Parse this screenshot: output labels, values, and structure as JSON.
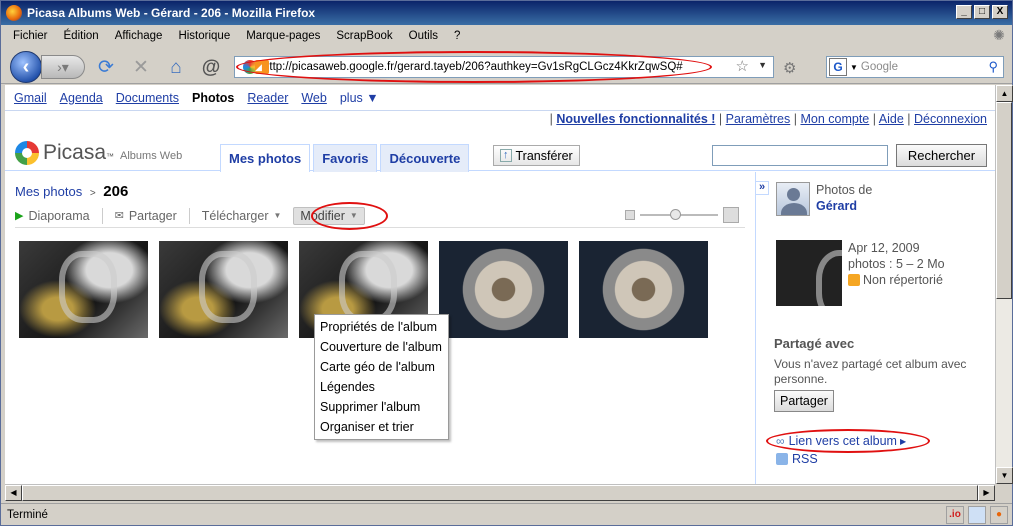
{
  "window": {
    "title": "Picasa Albums Web - Gérard - 206 - Mozilla Firefox",
    "buttons": [
      "_",
      "□",
      "X"
    ]
  },
  "menu": [
    "Fichier",
    "Édition",
    "Affichage",
    "Historique",
    "Marque-pages",
    "ScrapBook",
    "Outils",
    "?"
  ],
  "toolbar": {
    "url": "http://picasaweb.google.fr/gerard.tayeb/206?authkey=Gv1sRgCLGcz4KkrZqwSQ#",
    "search_placeholder": "Google"
  },
  "google_bar": {
    "links": [
      "Gmail",
      "Agenda",
      "Documents",
      "Photos",
      "Reader",
      "Web",
      "plus ▼"
    ],
    "current": "Photos"
  },
  "top_links": {
    "new_features": "Nouvelles fonctionnalités !",
    "settings": "Paramètres",
    "account": "Mon compte",
    "help": "Aide",
    "logout": "Déconnexion",
    "sep": "|"
  },
  "picasa": {
    "logo_name": "Picasa",
    "logo_tm": "™",
    "logo_sub": "Albums Web",
    "tabs": [
      "Mes photos",
      "Favoris",
      "Découverte"
    ],
    "active_tab": "Mes photos",
    "upload_label": "Transférer",
    "search_value": "",
    "search_button": "Rechercher"
  },
  "album": {
    "breadcrumb_parent": "Mes photos",
    "breadcrumb_sep": ">",
    "name": "206",
    "actions": {
      "slideshow": "Diaporama",
      "share": "Partager",
      "download": "Télécharger",
      "edit": "Modifier"
    },
    "edit_menu": [
      "Propriétés de l'album",
      "Couverture de l'album",
      "Carte géo de l'album",
      "Légendes",
      "Supprimer l'album",
      "Organiser et trier"
    ],
    "thumbnail_zoom": 0.45
  },
  "sidebar": {
    "owner_label": "Photos de",
    "owner_name": "Gérard",
    "date": "Apr 12, 2009",
    "photos": "photos : 5 – 2 Mo",
    "visibility": "Non répertorié",
    "shared_title": "Partagé avec",
    "shared_text": "Vous n'avez partagé cet album avec personne.",
    "share_button": "Partager",
    "link_label": "Lien vers cet album",
    "rss_label": "RSS"
  },
  "status": {
    "text": "Terminé",
    "io": ".io"
  },
  "colors": {
    "link": "#1f3ea5",
    "highlight_ellipse": "#e01010",
    "titlebar": "#0a246a"
  }
}
